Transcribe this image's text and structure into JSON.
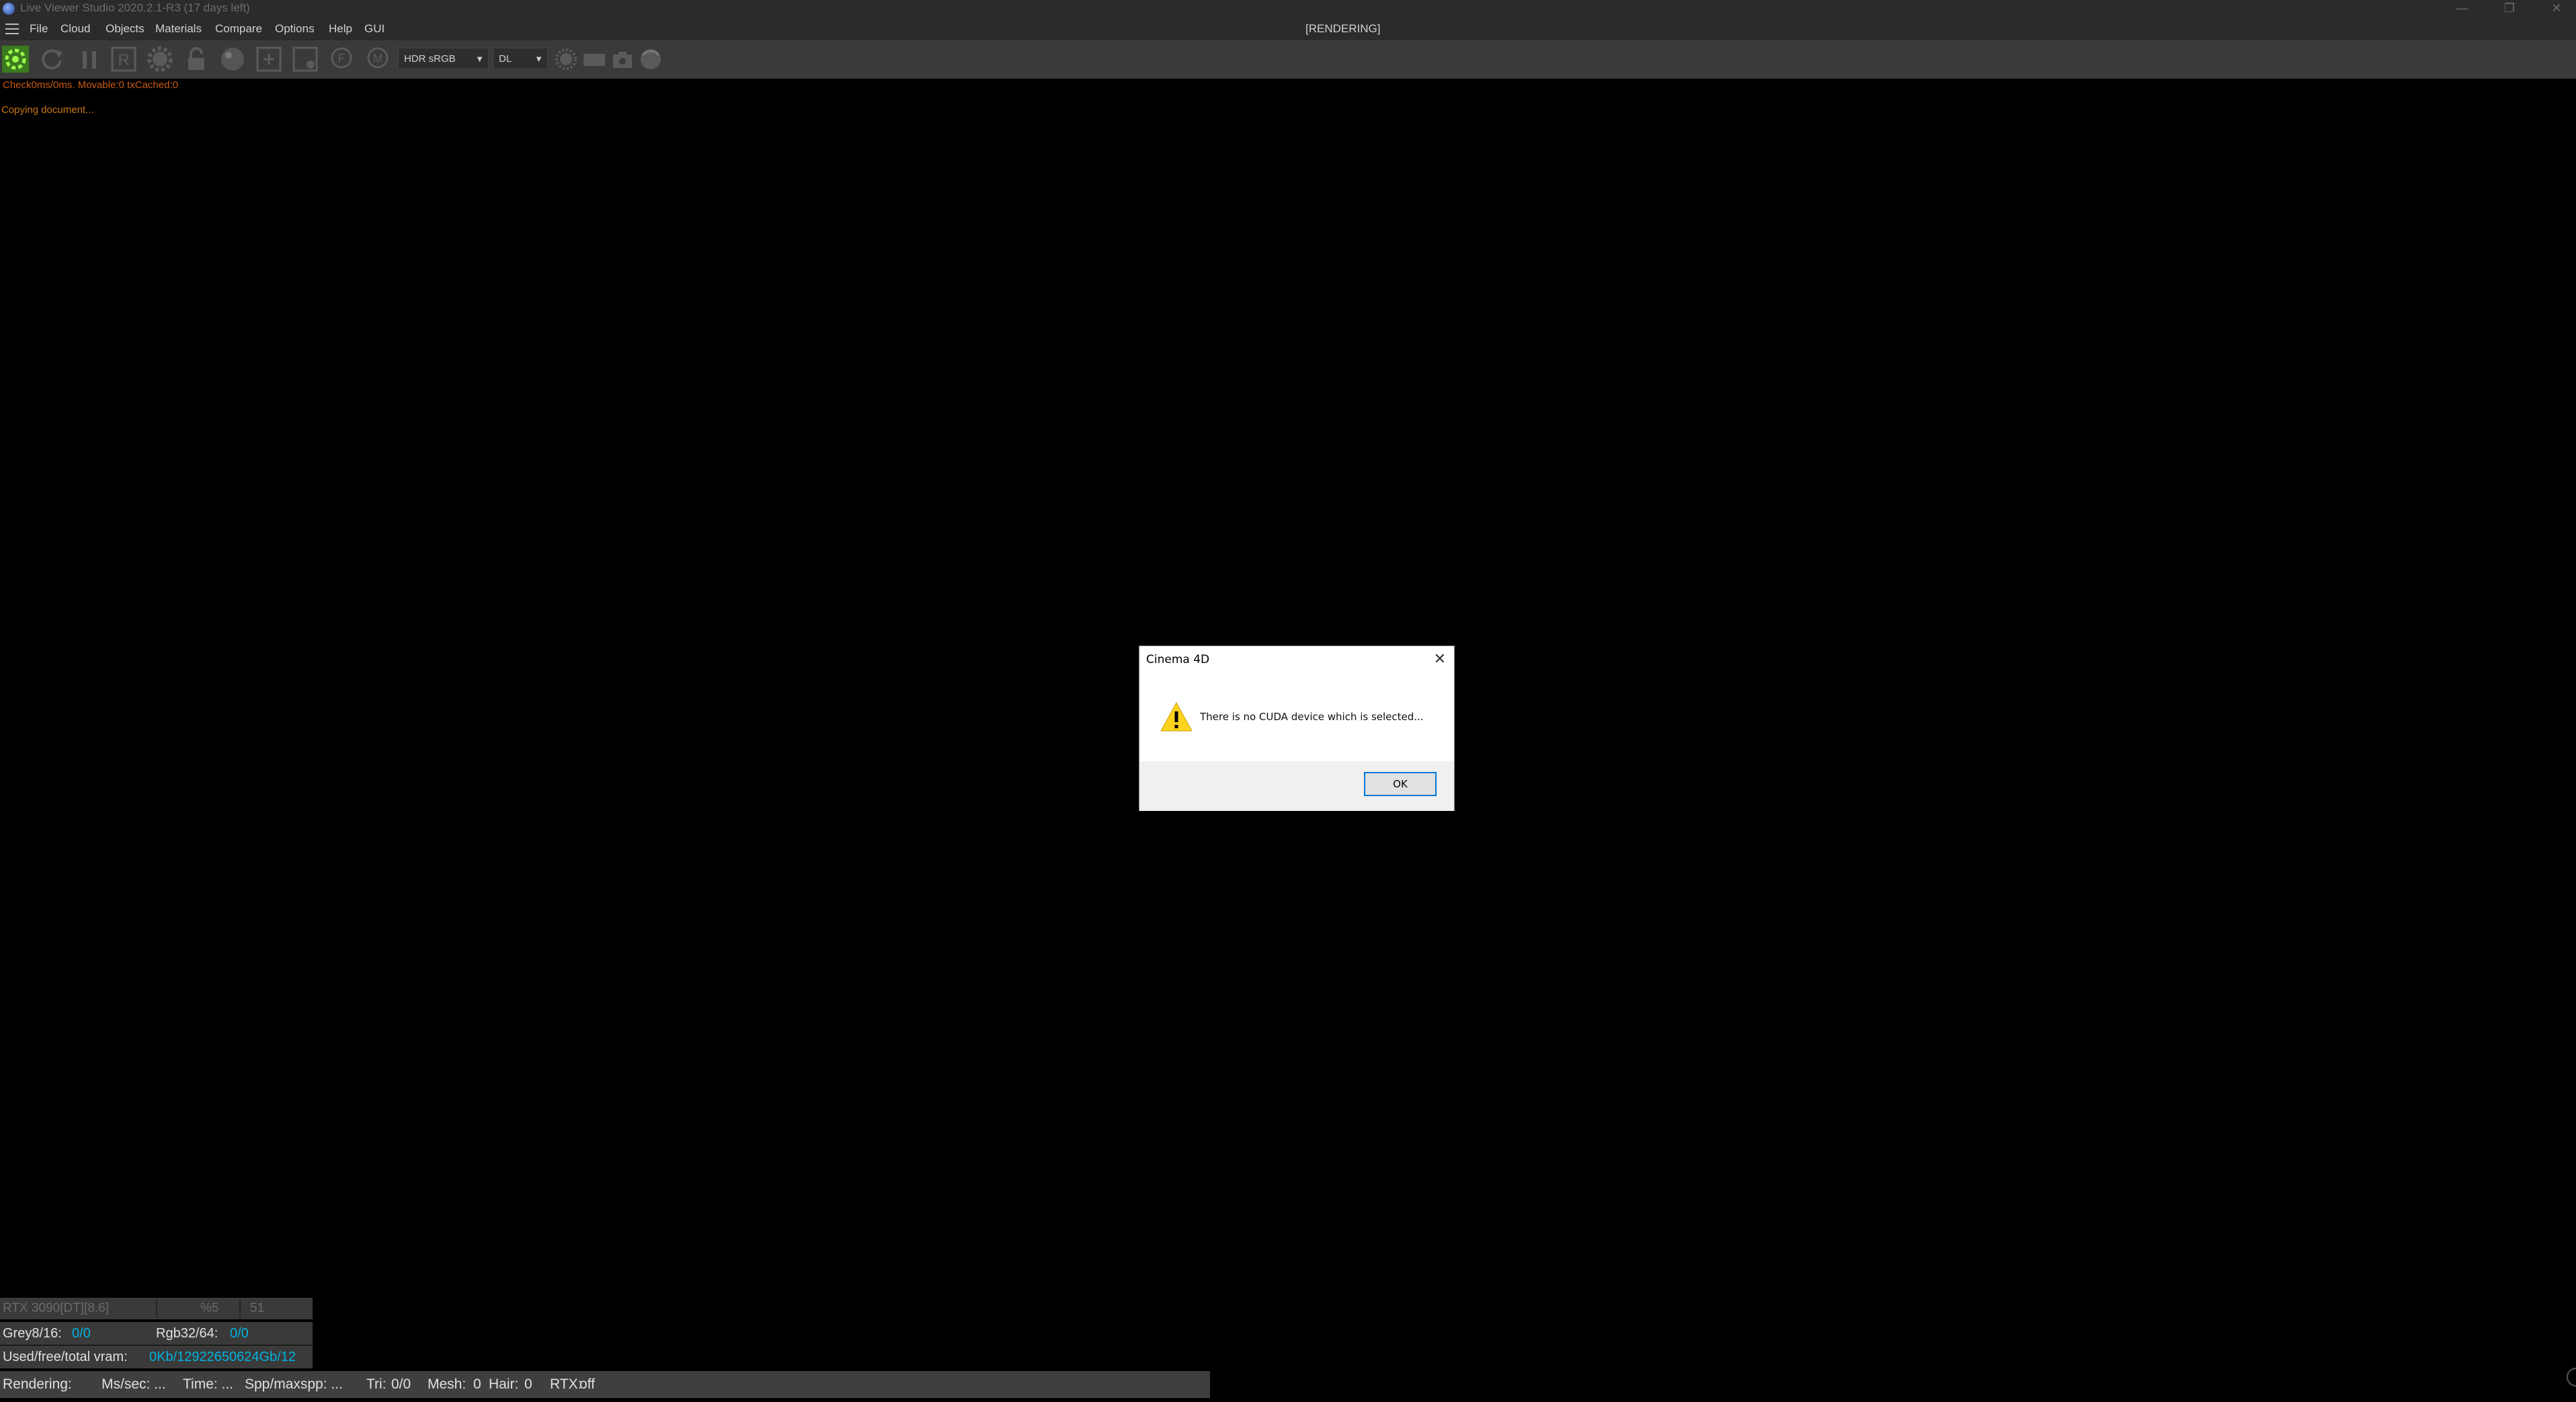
{
  "window": {
    "title": "Live Viewer Studio 2020.2.1-R3 (17 days left)",
    "minimize": "—",
    "restore": "❐",
    "close": "✕"
  },
  "menu": {
    "items": [
      "File",
      "Cloud",
      "Objects",
      "Materials",
      "Compare",
      "Options",
      "Help",
      "GUI"
    ],
    "state": "[RENDERING]"
  },
  "toolbar": {
    "icons": [
      "start-render-icon",
      "refresh-icon",
      "pause-icon",
      "region-r-icon",
      "settings-gear-icon",
      "lock-icon",
      "material-ball-icon",
      "add-object-icon",
      "clay-icon",
      "focus-f-icon",
      "marker-m-icon",
      "light-icon",
      "film-icon",
      "camera-icon",
      "sphere-icon"
    ],
    "colorspace": "HDR sRGB",
    "kernel": "DL"
  },
  "log": {
    "check": "Check0ms/0ms. Movable:0 txCached:0",
    "status": "Copying document..."
  },
  "dialog": {
    "title": "Cinema 4D",
    "message": "There is no CUDA device which is selected...",
    "ok": "OK",
    "close": "✕"
  },
  "stats": {
    "gpu": {
      "name": "RTX 3090[DT][8.6]",
      "percent": "%5",
      "temp": "51"
    },
    "grey_label": "Grey8/16:",
    "grey_value": "0/0",
    "rgb_label": "Rgb32/64:",
    "rgb_value": "0/0",
    "vram_label": "Used/free/total vram:",
    "vram_value": "0Kb/12922650624Gb/12"
  },
  "status_bar": {
    "rendering": "Rendering:",
    "ms_sec": "Ms/sec: ...",
    "time": "Time: ...",
    "spp": "Spp/maxspp: ...",
    "tri_label": "Tri:",
    "tri_value": "0/0",
    "mesh_label": "Mesh:",
    "mesh_value": "0",
    "hair_label": "Hair:",
    "hair_value": "0",
    "rtx_label": "RTX:",
    "rtx_value": "off"
  }
}
